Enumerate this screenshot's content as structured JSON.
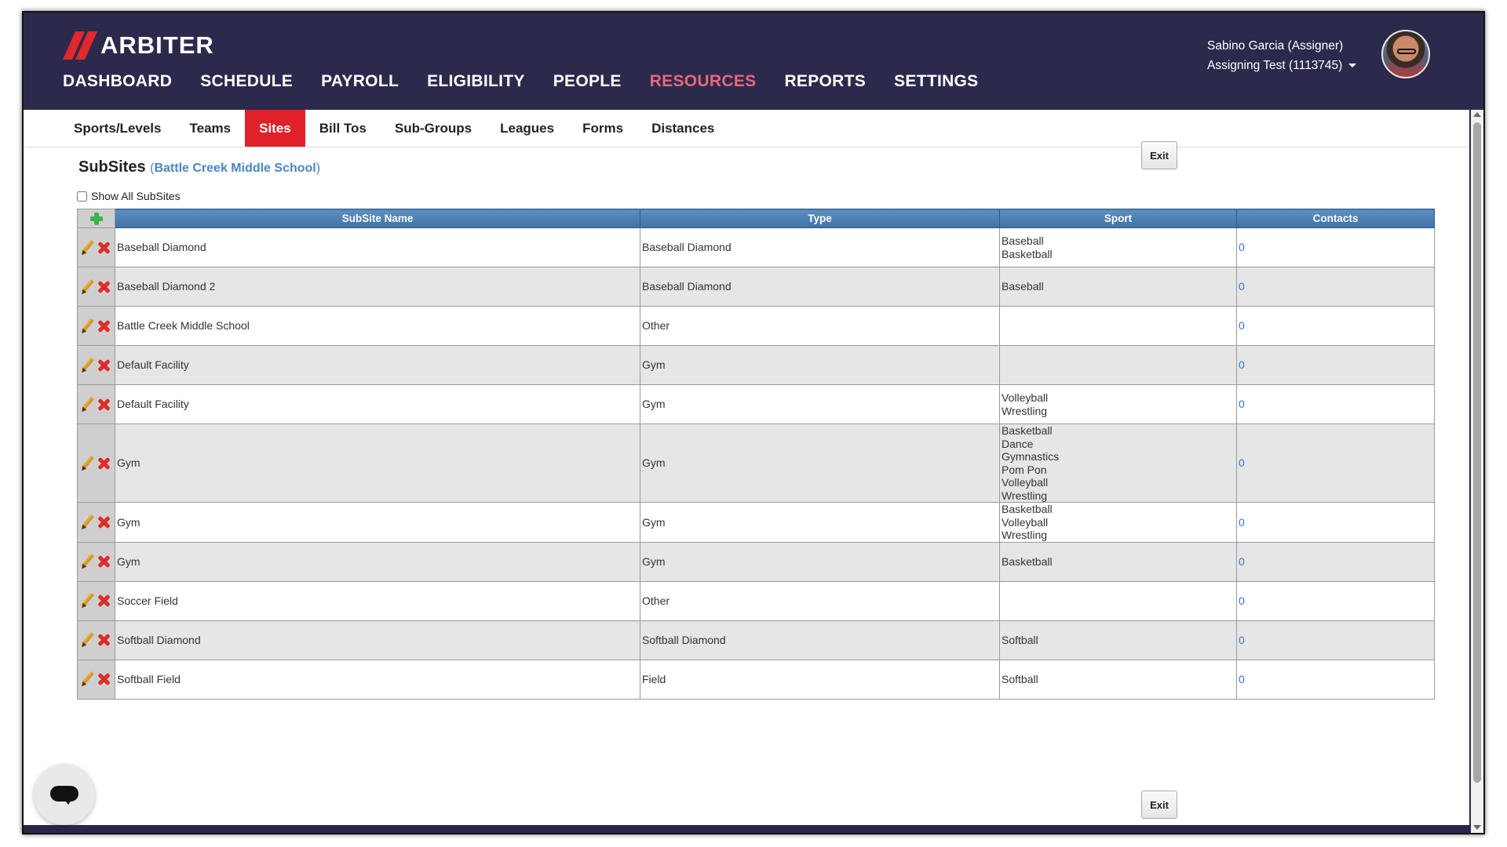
{
  "app": {
    "brand": "ARBITER",
    "main_nav": [
      "DASHBOARD",
      "SCHEDULE",
      "PAYROLL",
      "ELIGIBILITY",
      "PEOPLE",
      "RESOURCES",
      "REPORTS",
      "SETTINGS"
    ],
    "active_nav": "RESOURCES",
    "accent_color": "#e0202a",
    "header_color": "#2b2a4c"
  },
  "user": {
    "name": "Sabino Garcia (Assigner)",
    "account": "Assigning Test (1113745)"
  },
  "sub_nav": [
    "Sports/Levels",
    "Teams",
    "Sites",
    "Bill Tos",
    "Sub-Groups",
    "Leagues",
    "Forms",
    "Distances"
  ],
  "active_sub_nav": "Sites",
  "page": {
    "title": "SubSites",
    "paren_open": "(",
    "site_name": "Battle Creek Middle School",
    "paren_close": ")",
    "exit_label": "Exit",
    "show_all_label": "Show All SubSites"
  },
  "table": {
    "headers": [
      "SubSite Name",
      "Type",
      "Sport",
      "Contacts"
    ],
    "rows": [
      {
        "name": "Baseball Diamond",
        "type": "Baseball Diamond",
        "sports": [
          "Baseball",
          "Basketball"
        ],
        "contacts": "0"
      },
      {
        "name": "Baseball Diamond 2",
        "type": "Baseball Diamond",
        "sports": [
          "Baseball"
        ],
        "contacts": "0"
      },
      {
        "name": "Battle Creek Middle School",
        "type": "Other",
        "sports": [],
        "contacts": "0"
      },
      {
        "name": "Default Facility",
        "type": "Gym",
        "sports": [],
        "contacts": "0"
      },
      {
        "name": "Default Facility",
        "type": "Gym",
        "sports": [
          "Volleyball",
          "Wrestling"
        ],
        "contacts": "0"
      },
      {
        "name": "Gym",
        "type": "Gym",
        "sports": [
          "Basketball",
          "Dance",
          "Gymnastics",
          "Pom Pon",
          "Volleyball",
          "Wrestling"
        ],
        "contacts": "0"
      },
      {
        "name": "Gym",
        "type": "Gym",
        "sports": [
          "Basketball",
          "Volleyball",
          "Wrestling"
        ],
        "contacts": "0"
      },
      {
        "name": "Gym",
        "type": "Gym",
        "sports": [
          "Basketball"
        ],
        "contacts": "0"
      },
      {
        "name": "Soccer Field",
        "type": "Other",
        "sports": [],
        "contacts": "0"
      },
      {
        "name": "Softball Diamond",
        "type": "Softball Diamond",
        "sports": [
          "Softball"
        ],
        "contacts": "0"
      },
      {
        "name": "Softball Field",
        "type": "Field",
        "sports": [
          "Softball"
        ],
        "contacts": "0"
      }
    ]
  },
  "icons": {
    "add": "plus-icon",
    "edit": "pencil-icon",
    "delete": "delete-x-icon",
    "chat": "chat-bubble-icon"
  }
}
